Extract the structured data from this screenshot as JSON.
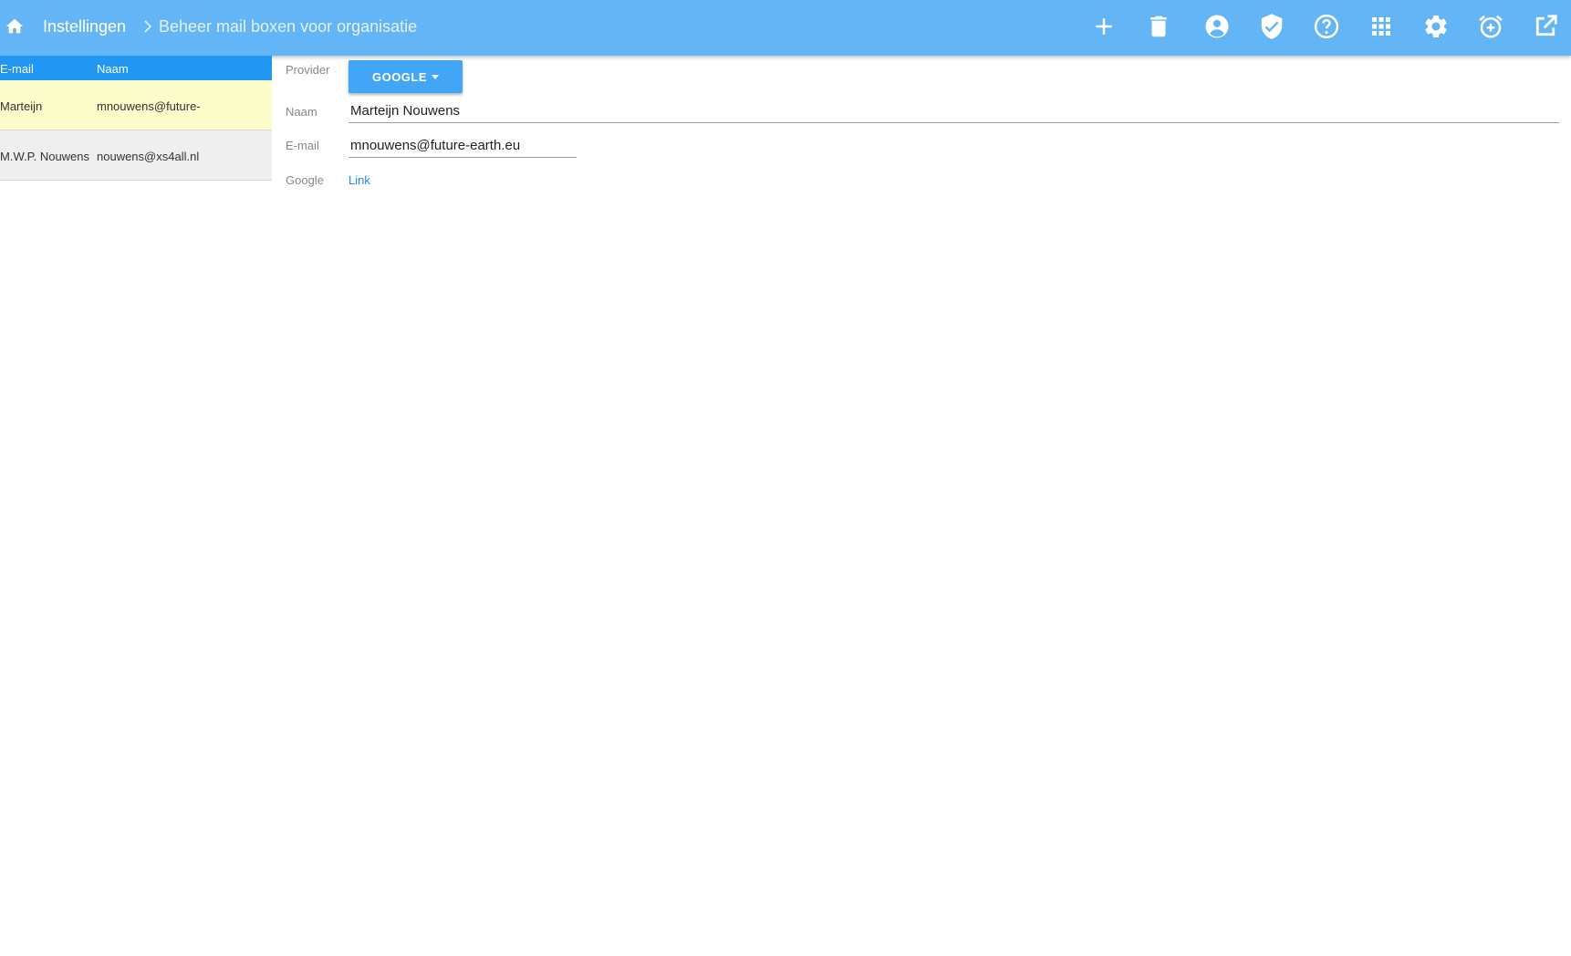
{
  "header": {
    "breadcrumb_root": "Instellingen",
    "breadcrumb_current": "Beheer mail boxen voor organisatie",
    "toolbar_icons": [
      "add-icon",
      "delete-icon",
      "account-icon",
      "shield-check-icon",
      "help-icon",
      "apps-grid-icon",
      "settings-icon",
      "alarm-add-icon",
      "open-external-icon"
    ]
  },
  "list": {
    "columns": [
      "E-mail",
      "Naam"
    ],
    "rows": [
      {
        "email": "Marteijn",
        "name": "mnouwens@future-",
        "selected": true
      },
      {
        "email": "M.W.P. Nouwens",
        "name": "nouwens@xs4all.nl",
        "selected": false
      }
    ]
  },
  "form": {
    "provider_label": "Provider",
    "provider_value": "GOOGLE",
    "name_label": "Naam",
    "name_value": "Marteijn Nouwens",
    "email_label": "E-mail",
    "email_value": "mnouwens@future-earth.eu",
    "google_label": "Google",
    "google_link": "Link"
  },
  "colors": {
    "topbar": "#64b5f6",
    "list_header": "#2196f3",
    "selected_row": "#fdfdcc",
    "button": "#42a5f5",
    "link": "#1e88e5"
  }
}
